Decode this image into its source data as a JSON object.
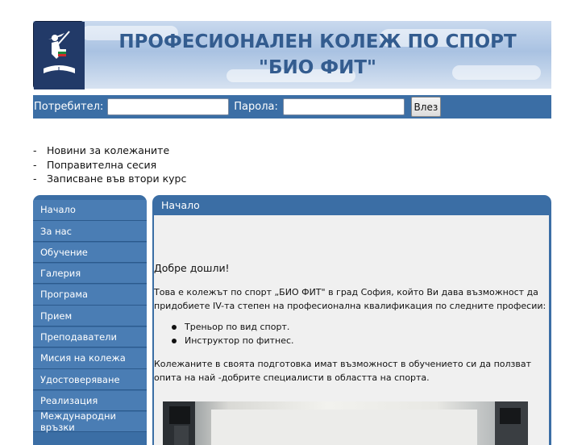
{
  "header": {
    "title_line1": "ПРОФЕСИОНАЛЕН КОЛЕЖ ПО СПОРТ",
    "title_line2": "\"БИО ФИТ\"",
    "logo_icon": "college-logo-icon"
  },
  "login": {
    "user_label": "Потребител:",
    "user_value": "",
    "password_label": "Парола:",
    "password_value": "",
    "submit_label": "Влез"
  },
  "news": [
    "Новини за колежаните",
    "Поправителна сесия",
    "Записване във втори курс"
  ],
  "menu": [
    "Начало",
    "За нас",
    "Обучение",
    "Галерия",
    "Програма",
    "Прием",
    "Преподаватели",
    "Мисия на колежа",
    "Удостоверяване",
    "Реализация",
    "Международни връзки"
  ],
  "content": {
    "title": "Начало",
    "welcome": "Добре дошли!",
    "intro": "Това е колежът по спорт „БИО ФИТ\" в град София, който Ви дава възможност да придобиете IV-та степен  на професионална квалификация по следните професии:",
    "professions": [
      "Треньор по вид спорт.",
      "Инструктор по фитнес."
    ],
    "outro": "Колежаните в своята подготовка имат възможност в обучението си  да ползват опита на най -добрите специалисти в областта на спорта."
  },
  "colors": {
    "bar": "#3b6ea5",
    "menu_item": "#4a7db4",
    "title_text": "#335c8f"
  }
}
